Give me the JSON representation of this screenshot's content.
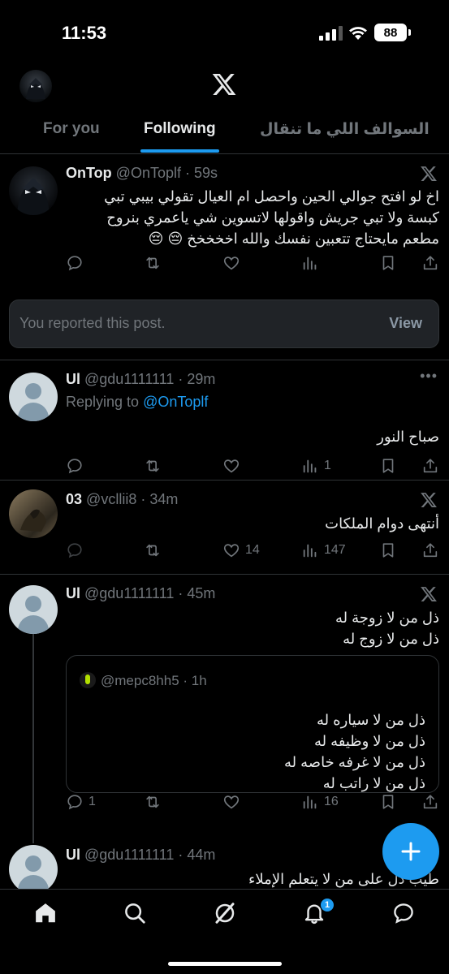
{
  "status": {
    "time": "11:53",
    "battery": "88"
  },
  "tabs": {
    "for_you": "For you",
    "following": "Following",
    "list": "السوالف اللي ما تنقال"
  },
  "posts": [
    {
      "name": "OnTop",
      "meta": "@OnToplf · 59s",
      "body_lines": [
        "اخ لو افتح جوالي الحين واحصل ام العيال تقولي بيبي تبي",
        "كبسة ولا تبي جريش واقولها لاتسوين شي ياعمري بنروح",
        "مطعم مايحتاج تتعبين نفسك والله اخخخخخ 😔 😔"
      ],
      "stats": {
        "reply": "",
        "repost": "",
        "like": "",
        "views": ""
      }
    },
    {
      "name": "Ul",
      "meta": "@gdu1111111 · 29m",
      "replying_label": "Replying to",
      "replying_handle": "@OnToplf",
      "body_lines": [
        "صباح النور"
      ],
      "stats": {
        "reply": "",
        "repost": "",
        "like": "",
        "views": "1"
      }
    },
    {
      "name": "03",
      "meta": "@vcllii8 · 34m",
      "body_lines": [
        "أنتهى دوام الملكات"
      ],
      "stats": {
        "reply": "",
        "repost": "",
        "like": "14",
        "views": "147"
      }
    },
    {
      "name": "Ul",
      "meta": "@gdu1111111 · 45m",
      "body_lines": [
        "ذل من لا زوجة له",
        "ذل من لا زوج له"
      ],
      "quote": {
        "meta": "@mepc8hh5 · 1h",
        "body_lines": [
          "ذل من لا سياره له",
          "ذل من لا وظيفه له",
          "ذل من لا غرفه خاصه له",
          "ذل من لا راتب له"
        ]
      },
      "stats": {
        "reply": "1",
        "repost": "",
        "like": "",
        "views": "16"
      }
    },
    {
      "name": "Ul",
      "meta": "@gdu1111111 · 44m",
      "body_lines": [
        "طيب ذل على من لا يتعلم الإملاء"
      ]
    }
  ],
  "reported": {
    "message": "You reported this post.",
    "view_label": "View"
  },
  "nav": {
    "notifications_badge": "1"
  }
}
